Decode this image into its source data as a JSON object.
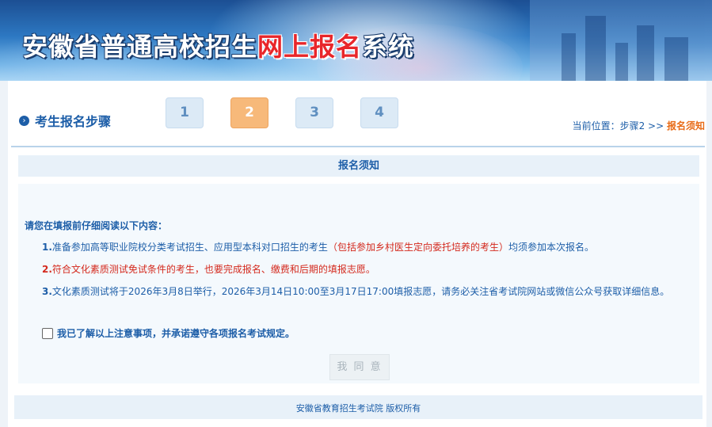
{
  "banner": {
    "title_prefix": "安徽省普通高校招生",
    "title_highlight": "网上报名",
    "title_suffix": "系统"
  },
  "steps": {
    "header_icon": "chevron-right-icon",
    "header_label": "考生报名步骤",
    "items": [
      {
        "label": "1",
        "active": false
      },
      {
        "label": "2",
        "active": true
      },
      {
        "label": "3",
        "active": false
      },
      {
        "label": "4",
        "active": false
      }
    ]
  },
  "breadcrumb": {
    "prefix": "当前位置：步骤2 >> ",
    "current": "报名须知"
  },
  "notice": {
    "section_title": "报名须知",
    "intro": "请您在填报前仔细阅读以下内容：",
    "item1": {
      "num": "1.",
      "text_a": "准备参加高等职业院校分类考试招生、应用型本科对口招生的考生",
      "text_red": "（包括参加乡村医生定向委托培养的考生）",
      "text_b": "均须参加本次报名。"
    },
    "item2": {
      "num": "2.",
      "text": "符合文化素质测试免试条件的考生，也要完成报名、缴费和后期的填报志愿。"
    },
    "item3": {
      "num": "3.",
      "text": "文化素质测试将于2026年3月8日举行，2026年3月14日10:00至3月17日17:00填报志愿，请务必关注省考试院网站或微信公众号获取详细信息。"
    },
    "agree_label": "我已了解以上注意事项，并承诺遵守各项报名考试规定。",
    "agree_checked": false,
    "button_label": "我 同 意"
  },
  "footer": {
    "text": "安徽省教育招生考试院 版权所有"
  },
  "colors": {
    "primary": "#1d5ea8",
    "active_step": "#f7b97a",
    "highlight": "#e8262a",
    "warning": "#d42a1e",
    "crumb_current": "#e86b17"
  }
}
